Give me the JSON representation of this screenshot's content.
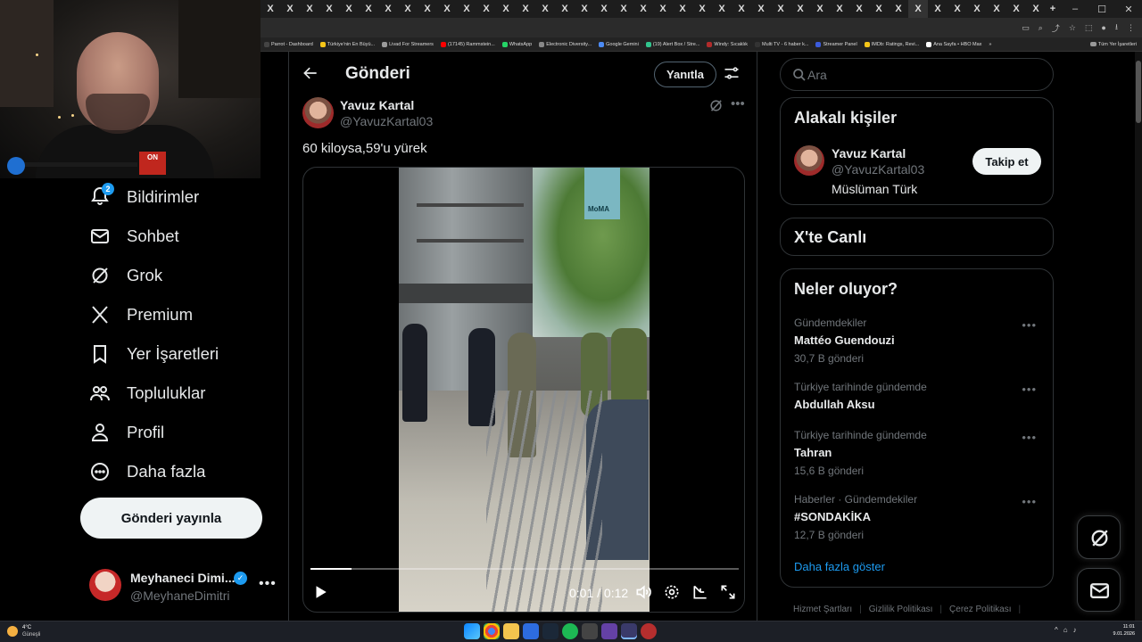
{
  "browser": {
    "tab_count": 40,
    "tab_icon": "x-logo",
    "new_tab_label": "+",
    "bookmarks": [
      {
        "label": "Parrot - Dashboard",
        "color": "#444444"
      },
      {
        "label": "Türkiye'nin En Büyü...",
        "color": "#f5c518"
      },
      {
        "label": "Livad For Streamers",
        "color": "#9b9b9b"
      },
      {
        "label": "(17145) Rammstein...",
        "color": "#ff0000"
      },
      {
        "label": "WhatsApp",
        "color": "#25d366"
      },
      {
        "label": "Electronic Diversity...",
        "color": "#888888"
      },
      {
        "label": "Google Gemini",
        "color": "#4c8bf5"
      },
      {
        "label": "(19) Alert Box / Stre...",
        "color": "#31c48d"
      },
      {
        "label": "Windy: Sıcaklık",
        "color": "#b12b2b"
      },
      {
        "label": "Multi TV - 6 haber k...",
        "color": "#333333"
      },
      {
        "label": "Streamer Panel",
        "color": "#3b5bdb"
      },
      {
        "label": "IMDb: Ratings, Revi...",
        "color": "#f5c518"
      },
      {
        "label": "Ana Sayfa • HBO Max",
        "color": "#ffffff"
      }
    ],
    "bookmarks_overflow": "»",
    "all_bookmarks": "Tüm Yer İşaretleri"
  },
  "nav": {
    "items": [
      {
        "label": "Bildirimler",
        "icon": "bell-icon",
        "badge": "2"
      },
      {
        "label": "Sohbet",
        "icon": "mail-icon"
      },
      {
        "label": "Grok",
        "icon": "grok-icon"
      },
      {
        "label": "Premium",
        "icon": "x-logo-icon"
      },
      {
        "label": "Yer İşaretleri",
        "icon": "bookmark-icon"
      },
      {
        "label": "Topluluklar",
        "icon": "communities-icon"
      },
      {
        "label": "Profil",
        "icon": "profile-icon"
      },
      {
        "label": "Daha fazla",
        "icon": "more-circle-icon"
      }
    ],
    "post_button": "Gönderi yayınla",
    "account": {
      "name": "Meyhaneci Dimi...",
      "handle": "@MeyhaneDimitri"
    }
  },
  "main": {
    "title": "Gönderi",
    "reply_button": "Yanıtla",
    "post": {
      "author_name": "Yavuz Kartal",
      "author_handle": "@YavuzKartal03",
      "text": "60 kiloysa,59'u yürek",
      "video": {
        "current_time": "0:01",
        "duration": "0:12",
        "progress": 0.095,
        "sign_text": "MoMA"
      }
    }
  },
  "right": {
    "search_placeholder": "Ara",
    "related": {
      "title": "Alakalı kişiler",
      "name": "Yavuz Kartal",
      "handle": "@YavuzKartal03",
      "bio": "Müslüman Türk",
      "follow_button": "Takip et"
    },
    "live_title": "X'te Canlı",
    "trends": {
      "title": "Neler oluyor?",
      "items": [
        {
          "meta": "Gündemdekiler",
          "name": "Mattéo Guendouzi",
          "count": "30,7 B gönderi"
        },
        {
          "meta": "Türkiye tarihinde gündemde",
          "name": "Abdullah Aksu",
          "count": ""
        },
        {
          "meta": "Türkiye tarihinde gündemde",
          "name": "Tahran",
          "count": "15,6 B gönderi"
        },
        {
          "meta": "Haberler · Gündemdekiler",
          "name": "#SONDAKİKA",
          "count": "12,7 B gönderi"
        }
      ],
      "show_more": "Daha fazla göster"
    },
    "footer": [
      "Hizmet Şartları",
      "Gizlilik Politikası",
      "Çerez Politikası"
    ],
    "footer_sep": "|"
  },
  "taskbar": {
    "weather_temp": "4°C",
    "weather_cond": "Güneşli",
    "time": "11:01",
    "date": "9.01.2026",
    "tray_up": "^"
  },
  "webcam": {
    "badge": "ON"
  },
  "colors": {
    "accent": "#1d9bf0",
    "background": "#000000",
    "border": "#2f3336",
    "muted": "#71767b"
  }
}
